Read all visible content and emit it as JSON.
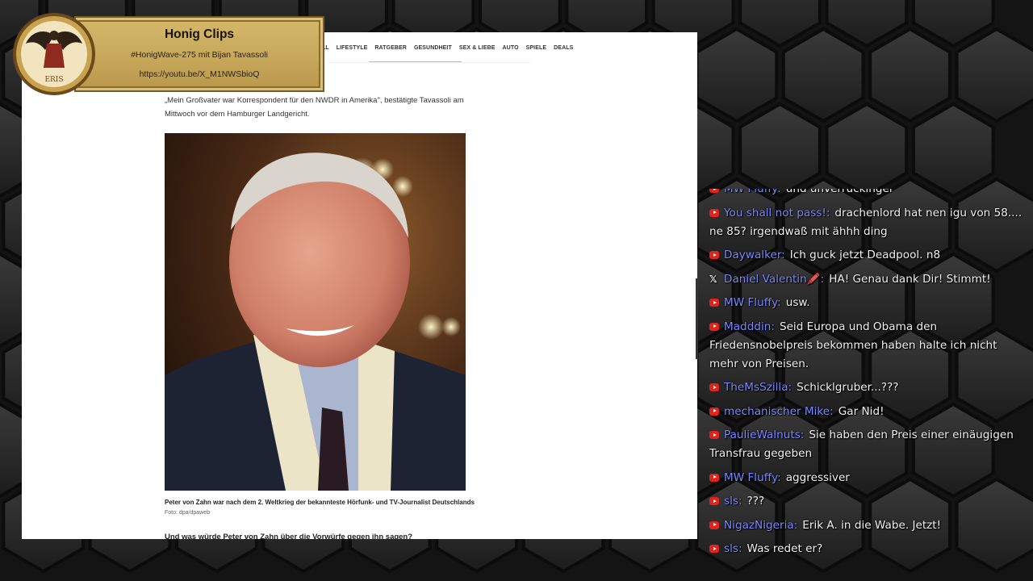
{
  "colors": {
    "username": "#7b86ff",
    "youtube_badge": "#e62117",
    "banner_gold": "#c7a85a"
  },
  "banner": {
    "title": "Honig Clips",
    "subtitle": "#HonigWave-275 mit Bijan Tavassoli",
    "url": "https://youtu.be/X_M1NWSbioQ",
    "logo_text": "ERIS"
  },
  "article": {
    "nav": [
      "LL",
      "LIFESTYLE",
      "RATGEBER",
      "GESUNDHEIT",
      "SEX & LIEBE",
      "AUTO",
      "SPIELE",
      "DEALS"
    ],
    "quote": "„Mein Großvater war Korrespondent für den NWDR in Amerika\", bestätigte Tavassoli am Mittwoch vor dem Hamburger Landgericht.",
    "caption": "Peter von Zahn war nach dem 2. Weltkrieg der bekannteste Hörfunk- und TV-Journalist Deutschlands",
    "credit": "Foto: dpa/dpaweb",
    "next_heading": "Und was würde Peter von Zahn über die Vorwürfe gegen ihn sagen?"
  },
  "chat": {
    "messages": [
      {
        "platform": "youtube",
        "user": "MW Fluffy",
        "text": "und unverrückinger"
      },
      {
        "platform": "youtube",
        "user": "You shall not pass!",
        "text": "drachenlord hat nen igu von 58.... ne 85? irgendwaß mit ähhh ding"
      },
      {
        "platform": "youtube",
        "user": "Daywalker",
        "text": "Ich guck jetzt Deadpool. n8"
      },
      {
        "platform": "x",
        "user": "Daniel Valentin🖍️",
        "text": "HA! Genau dank Dir! Stimmt!"
      },
      {
        "platform": "youtube",
        "user": "MW Fluffy",
        "text": "usw."
      },
      {
        "platform": "youtube",
        "user": "Madddin",
        "text": "Seid Europa und Obama den Friedensnobelpreis bekommen haben halte ich nicht mehr von Preisen."
      },
      {
        "platform": "youtube",
        "user": "TheMsSzilla",
        "text": "Schicklgruber...???"
      },
      {
        "platform": "youtube",
        "user": "mechanischer Mike",
        "text": "Gar Nid!"
      },
      {
        "platform": "youtube",
        "user": "PaulieWalnuts",
        "text": "Sie haben den Preis einer einäugigen Transfrau gegeben"
      },
      {
        "platform": "youtube",
        "user": "MW Fluffy",
        "text": "aggressiver"
      },
      {
        "platform": "youtube",
        "user": "sls",
        "text": "???"
      },
      {
        "platform": "youtube",
        "user": "NigazNigeria",
        "text": "Erik A. in die Wabe. Jetzt!"
      },
      {
        "platform": "youtube",
        "user": "sls",
        "text": "Was redet er?"
      }
    ]
  }
}
